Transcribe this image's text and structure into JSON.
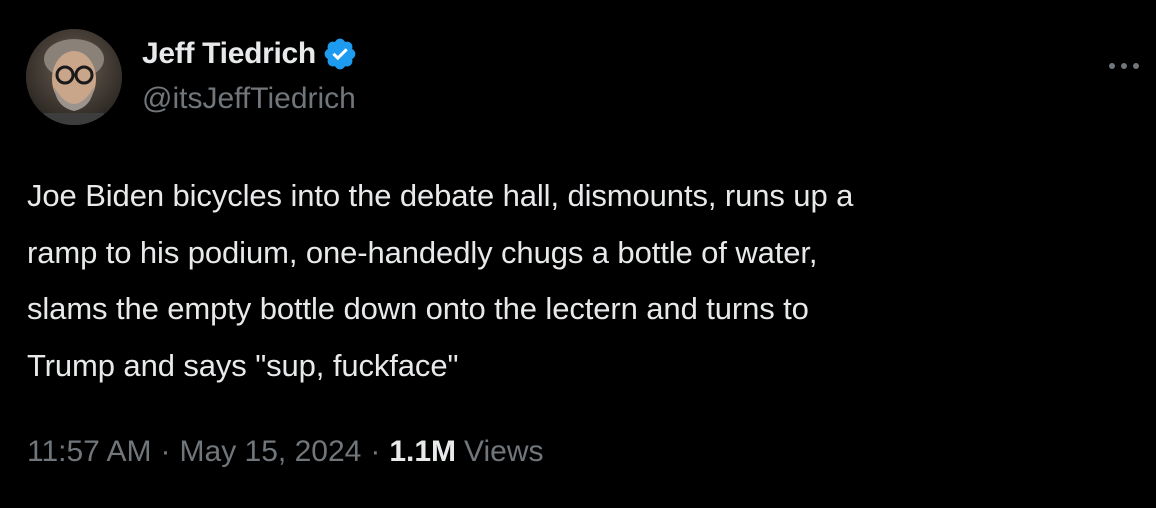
{
  "author": {
    "display_name": "Jeff Tiedrich",
    "handle": "@itsJeffTiedrich",
    "verified": true,
    "verified_color": "#1d9bf0"
  },
  "tweet": {
    "text_lines": [
      "Joe Biden bicycles into the debate hall, dismounts, runs up a",
      "ramp to his podium, one-handedly chugs a bottle of water,",
      "slams the empty bottle down onto the lectern and turns to",
      "Trump and says \"sup, fuckface\""
    ]
  },
  "meta": {
    "time": "11:57 AM",
    "separator": "·",
    "date": "May 15, 2024",
    "views_count": "1.1M",
    "views_label": "Views"
  },
  "icons": {
    "avatar": "avatar",
    "verified": "verified-badge-icon",
    "more": "more-options-icon"
  },
  "colors": {
    "background": "#000000",
    "primary_text": "#e7e9ea",
    "secondary_text": "#71767b"
  }
}
